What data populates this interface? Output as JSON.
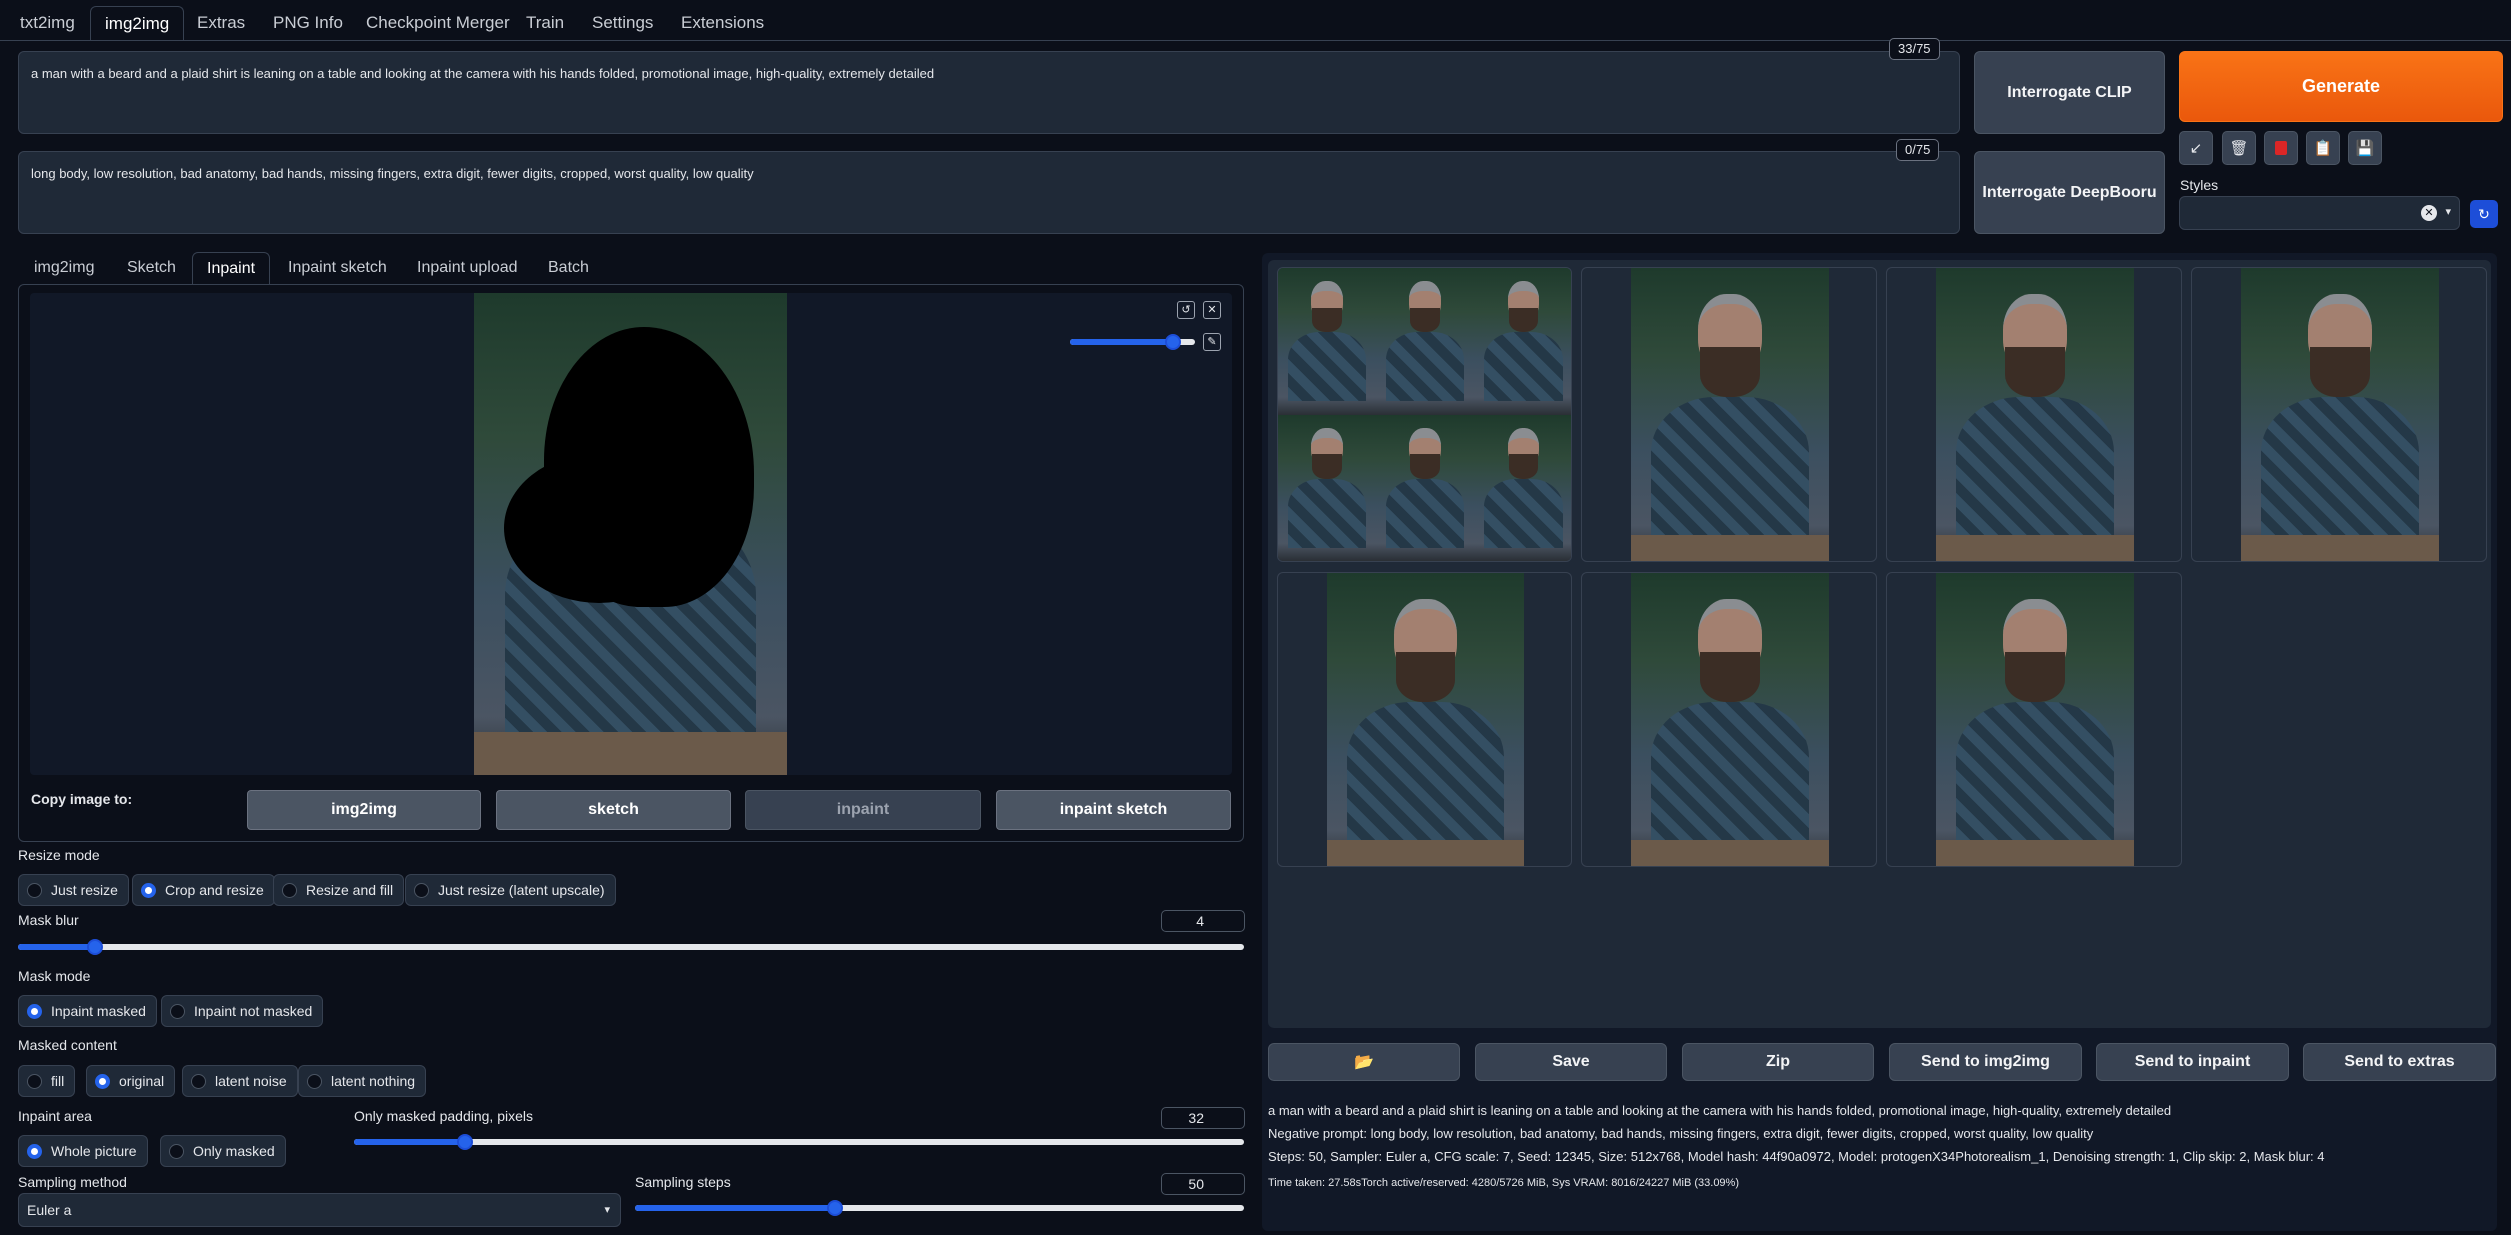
{
  "top_tabs": [
    "txt2img",
    "img2img",
    "Extras",
    "PNG Info",
    "Checkpoint Merger",
    "Train",
    "Settings",
    "Extensions"
  ],
  "prompt": {
    "value": "a man with a beard and a plaid shirt is leaning on a table and looking at the camera with his hands folded, promotional image, high-quality, extremely detailed",
    "counter": "33/75"
  },
  "negative_prompt": {
    "value": "long body, low resolution, bad anatomy, bad hands, missing fingers, extra digit, fewer digits, cropped, worst quality, low quality",
    "counter": "0/75"
  },
  "buttons": {
    "interrogate_clip": "Interrogate CLIP",
    "interrogate_deepbooru": "Interrogate DeepBooru",
    "generate": "Generate"
  },
  "tool_icons": [
    "arrow-icon",
    "trash-icon",
    "red-square-icon",
    "clipboard-icon",
    "save-icon"
  ],
  "styles": {
    "label": "Styles",
    "value": ""
  },
  "sub_tabs": [
    "img2img",
    "Sketch",
    "Inpaint",
    "Inpaint sketch",
    "Inpaint upload",
    "Batch"
  ],
  "canvas": {
    "brush_size": 0.82
  },
  "copy_image": {
    "label": "Copy image to:",
    "targets": [
      "img2img",
      "sketch",
      "inpaint",
      "inpaint sketch"
    ]
  },
  "resize_mode": {
    "label": "Resize mode",
    "options": [
      "Just resize",
      "Crop and resize",
      "Resize and fill",
      "Just resize (latent upscale)"
    ],
    "selected": "Crop and resize"
  },
  "mask_blur": {
    "label": "Mask blur",
    "value": "4",
    "min": 0,
    "max": 64
  },
  "mask_mode": {
    "label": "Mask mode",
    "options": [
      "Inpaint masked",
      "Inpaint not masked"
    ],
    "selected": "Inpaint masked"
  },
  "masked_content": {
    "label": "Masked content",
    "options": [
      "fill",
      "original",
      "latent noise",
      "latent nothing"
    ],
    "selected": "original"
  },
  "inpaint_area": {
    "label": "Inpaint area",
    "options": [
      "Whole picture",
      "Only masked"
    ],
    "selected": "Whole picture"
  },
  "padding": {
    "label": "Only masked padding, pixels",
    "value": "32",
    "min": 0,
    "max": 256
  },
  "sampling_method": {
    "label": "Sampling method",
    "value": "Euler a"
  },
  "sampling_steps": {
    "label": "Sampling steps",
    "value": "50",
    "min": 1,
    "max": 150
  },
  "result_actions": [
    "📂",
    "Save",
    "Zip",
    "Send to img2img",
    "Send to inpaint",
    "Send to extras"
  ],
  "gen_info": {
    "prompt": "a man with a beard and a plaid shirt is leaning on a table and looking at the camera with his hands folded, promotional image, high-quality, extremely detailed",
    "negative": "Negative prompt: long body, low resolution, bad anatomy, bad hands, missing fingers, extra digit, fewer digits, cropped, worst quality, low quality",
    "params": "Steps: 50, Sampler: Euler a, CFG scale: 7, Seed: 12345, Size: 512x768, Model hash: 44f90a0972, Model: protogenX34Photorealism_1, Denoising strength: 1, Clip skip: 2, Mask blur: 4",
    "time": "Time taken: 27.58sTorch active/reserved: 4280/5726 MiB, Sys VRAM: 8016/24227 MiB (33.09%)"
  },
  "colors": {
    "accent": "#2563eb",
    "generate": "#f97316",
    "background": "#0b0f19",
    "panel": "#1f2937"
  }
}
